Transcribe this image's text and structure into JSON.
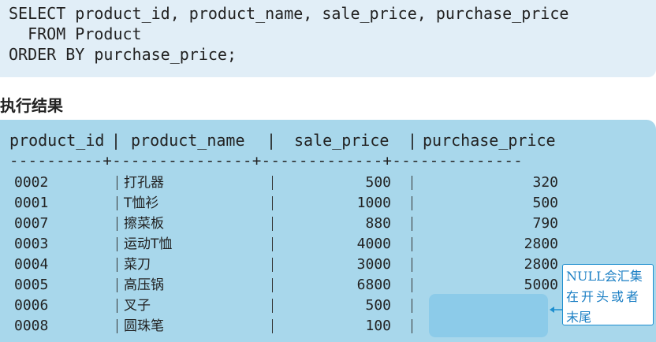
{
  "sql": {
    "lines": [
      "SELECT product_id, product_name, sale_price, purchase_price",
      "  FROM Product",
      "ORDER BY purchase_price;"
    ]
  },
  "section_title": "执行结果",
  "result": {
    "headers": [
      "product_id",
      "product_name",
      "sale_price",
      "purchase_price"
    ],
    "separator": "----------+---------------+-------------+--------------",
    "rows": [
      [
        "0002",
        "打孔器",
        "500",
        "320"
      ],
      [
        "0001",
        "T恤衫",
        "1000",
        "500"
      ],
      [
        "0007",
        "擦菜板",
        "880",
        "790"
      ],
      [
        "0003",
        "运动T恤",
        "4000",
        "2800"
      ],
      [
        "0004",
        "菜刀",
        "3000",
        "2800"
      ],
      [
        "0005",
        "高压锅",
        "6800",
        "5000"
      ],
      [
        "0006",
        "叉子",
        "500",
        ""
      ],
      [
        "0008",
        "圆珠笔",
        "100",
        ""
      ]
    ]
  },
  "callout": {
    "lines": [
      "NULL会汇集",
      "在开头或者",
      "末尾"
    ],
    "color": "#1b7fc4"
  }
}
